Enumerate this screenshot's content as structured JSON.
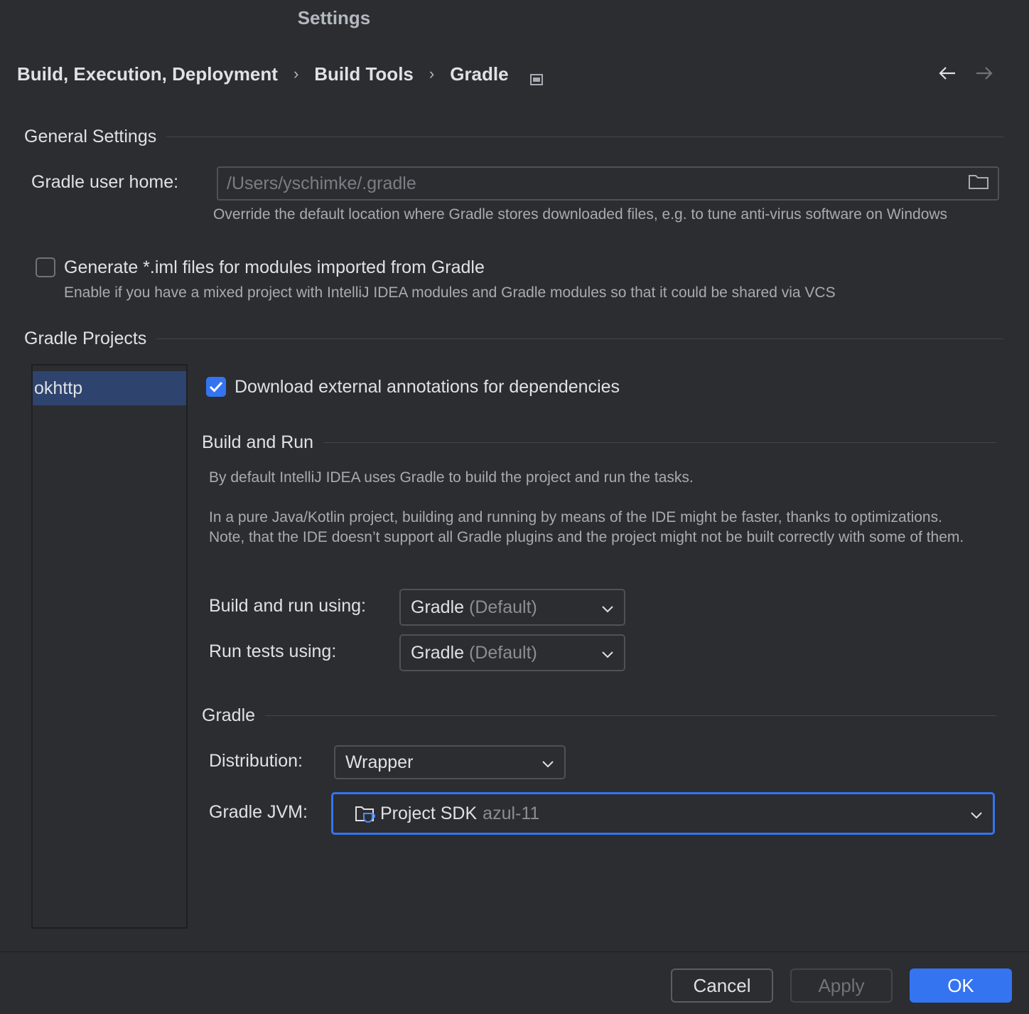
{
  "window": {
    "title": "Settings"
  },
  "breadcrumb": {
    "items": [
      "Build, Execution, Deployment",
      "Build Tools",
      "Gradle"
    ],
    "separator": "›"
  },
  "general": {
    "header": "General Settings",
    "gradle_user_home_label": "Gradle user home:",
    "gradle_user_home_value": "/Users/yschimke/.gradle",
    "gradle_user_home_hint": "Override the default location where Gradle stores downloaded files, e.g. to tune anti-virus software on Windows",
    "generate_iml_label": "Generate *.iml files for modules imported from Gradle",
    "generate_iml_checked": false,
    "generate_iml_hint": "Enable if you have a mixed project with IntelliJ IDEA modules and Gradle modules so that it could be shared via VCS"
  },
  "projects": {
    "header": "Gradle Projects",
    "items": [
      "okhttp"
    ]
  },
  "project_settings": {
    "download_annotations_label": "Download external annotations for dependencies",
    "download_annotations_checked": true,
    "build_and_run": {
      "header": "Build and Run",
      "desc1": "By default IntelliJ IDEA uses Gradle to build the project and run the tasks.",
      "desc2": "In a pure Java/Kotlin project, building and running by means of the IDE might be faster, thanks to optimizations. Note, that the IDE doesn’t support all Gradle plugins and the project might not be built correctly with some of them.",
      "build_run_using_label": "Build and run using:",
      "build_run_using_value": "Gradle",
      "build_run_using_suffix": "(Default)",
      "run_tests_using_label": "Run tests using:",
      "run_tests_using_value": "Gradle",
      "run_tests_using_suffix": "(Default)"
    },
    "gradle": {
      "header": "Gradle",
      "distribution_label": "Distribution:",
      "distribution_value": "Wrapper",
      "jvm_label": "Gradle JVM:",
      "jvm_value": "Project SDK",
      "jvm_suffix": "azul-11"
    }
  },
  "footer": {
    "cancel_label": "Cancel",
    "apply_label": "Apply",
    "ok_label": "OK"
  },
  "colors": {
    "background": "#2b2d30",
    "accent": "#3574f0",
    "selection": "#2e436e",
    "text": "#dfe1e5",
    "muted": "#8b8e94"
  }
}
